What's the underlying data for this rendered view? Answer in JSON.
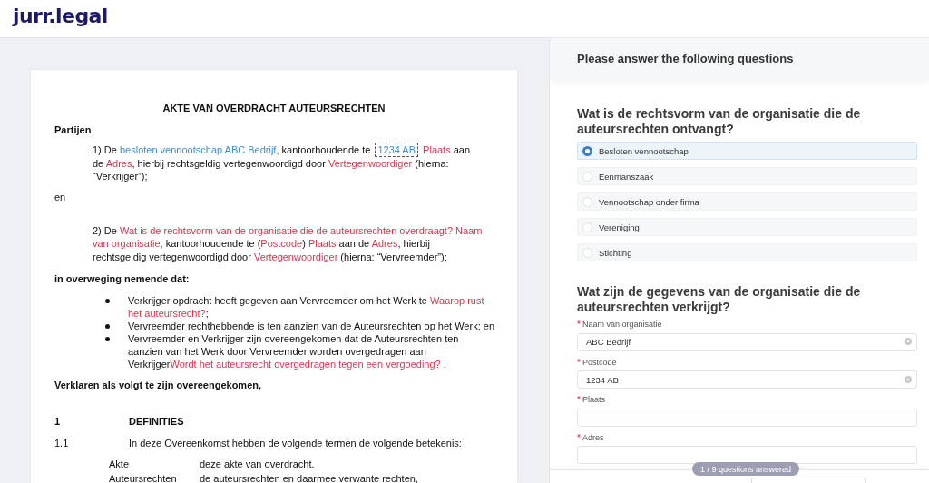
{
  "header": {
    "logo": "jurr.legal"
  },
  "document": {
    "title": "AKTE VAN OVERDRACHT AUTEURSRECHTEN",
    "blocks": [
      {
        "kind": "heading",
        "text": "Partijen"
      },
      {
        "kind": "party",
        "segments": [
          {
            "kind": "text",
            "text": "1) De "
          },
          {
            "kind": "answer",
            "text": "besloten vennootschap ABC Bedrijf"
          },
          {
            "kind": "text",
            "text": ", kantoorhoudende te "
          },
          {
            "kind": "focus",
            "text": "1234 AB"
          },
          {
            "kind": "placeholder",
            "text": " Plaats"
          },
          {
            "kind": "text",
            "text": " aan de "
          },
          {
            "kind": "placeholder",
            "text": "Adres"
          },
          {
            "kind": "text",
            "text": ", hierbij rechtsgeldig vertegenwoordigd door "
          },
          {
            "kind": "placeholder",
            "text": "Vertegenwoordiger"
          },
          {
            "kind": "text",
            "text": " (hierna: “Verkrijger”);"
          }
        ]
      },
      {
        "kind": "connector",
        "text": "en"
      },
      {
        "kind": "party",
        "segments": [
          {
            "kind": "text",
            "text": "2) De "
          },
          {
            "kind": "placeholder",
            "text": "Wat is de rechtsvorm van de organisatie die de auteursrechten overdraagt? Naam van organisatie"
          },
          {
            "kind": "text",
            "text": ", kantoorhoudende te ("
          },
          {
            "kind": "placeholder",
            "text": "Postcode"
          },
          {
            "kind": "text",
            "text": ") "
          },
          {
            "kind": "placeholder",
            "text": "Plaats"
          },
          {
            "kind": "text",
            "text": " aan de "
          },
          {
            "kind": "placeholder",
            "text": "Adres"
          },
          {
            "kind": "text",
            "text": ", hierbij rechtsgeldig vertegenwoordigd door "
          },
          {
            "kind": "placeholder",
            "text": "Vertegenwoordiger"
          },
          {
            "kind": "text",
            "text": " (hierna: “Vervreemder”);"
          }
        ]
      },
      {
        "kind": "heading",
        "text": "in overweging nemende dat:"
      },
      {
        "kind": "bullets",
        "items": [
          {
            "segments": [
              {
                "kind": "text",
                "text": "Verkrijger opdracht heeft gegeven aan Vervreemder om het Werk te "
              },
              {
                "kind": "placeholder",
                "text": "Waarop rust het auteursrecht?"
              },
              {
                "kind": "text",
                "text": ";"
              }
            ]
          },
          {
            "segments": [
              {
                "kind": "text",
                "text": "Vervreemder rechthebbende is ten aanzien van de Auteursrechten op het Werk; en"
              }
            ]
          },
          {
            "segments": [
              {
                "kind": "text",
                "text": "Vervreemder en Verkrijger zijn overeengekomen dat de Auteursrechten ten aanzien van het Werk door Vervreemder worden overgedragen aan Verkrijger"
              },
              {
                "kind": "placeholder",
                "text": "Wordt het auteursrecht overgedragen tegen een vergoeding?"
              },
              {
                "kind": "text",
                "text": " ."
              }
            ]
          }
        ]
      },
      {
        "kind": "closing",
        "text": "Verklaren als volgt te zijn overeengekomen,"
      },
      {
        "kind": "section",
        "number": "1",
        "text": "DEFINITIES"
      },
      {
        "kind": "clause",
        "number": "1.1",
        "text": "In deze Overeenkomst hebben de volgende termen de volgende betekenis:"
      },
      {
        "kind": "definitions",
        "items": [
          {
            "term": "Akte",
            "definition": "deze akte van overdracht."
          },
          {
            "term": "Auteursrechten",
            "definition": "de auteursrechten en daarmee verwante rechten,"
          }
        ]
      }
    ]
  },
  "questions_panel": {
    "title": "Please answer the following questions",
    "questions": [
      {
        "kind": "choice",
        "title": "Wat is de rechtsvorm van de organisatie die de auteursrechten ontvangt?",
        "options": [
          {
            "label": "Besloten vennootschap",
            "selected": true
          },
          {
            "label": "Eenmanszaak",
            "selected": false
          },
          {
            "label": "Vennootschap onder firma",
            "selected": false
          },
          {
            "label": "Vereniging",
            "selected": false
          },
          {
            "label": "Stichting",
            "selected": false
          }
        ]
      },
      {
        "kind": "fields",
        "title": "Wat zijn de gegevens van de organisatie die de auteursrechten verkrijgt?",
        "fields": [
          {
            "label": "Naam van organisatie",
            "required": true,
            "value": "ABC Bedrijf"
          },
          {
            "label": "Postcode",
            "required": true,
            "value": "1234 AB"
          },
          {
            "label": "Plaats",
            "required": true
          },
          {
            "label": "Adres",
            "required": true
          }
        ]
      }
    ]
  },
  "footer": {
    "progress": "1 / 9 questions answered"
  }
}
